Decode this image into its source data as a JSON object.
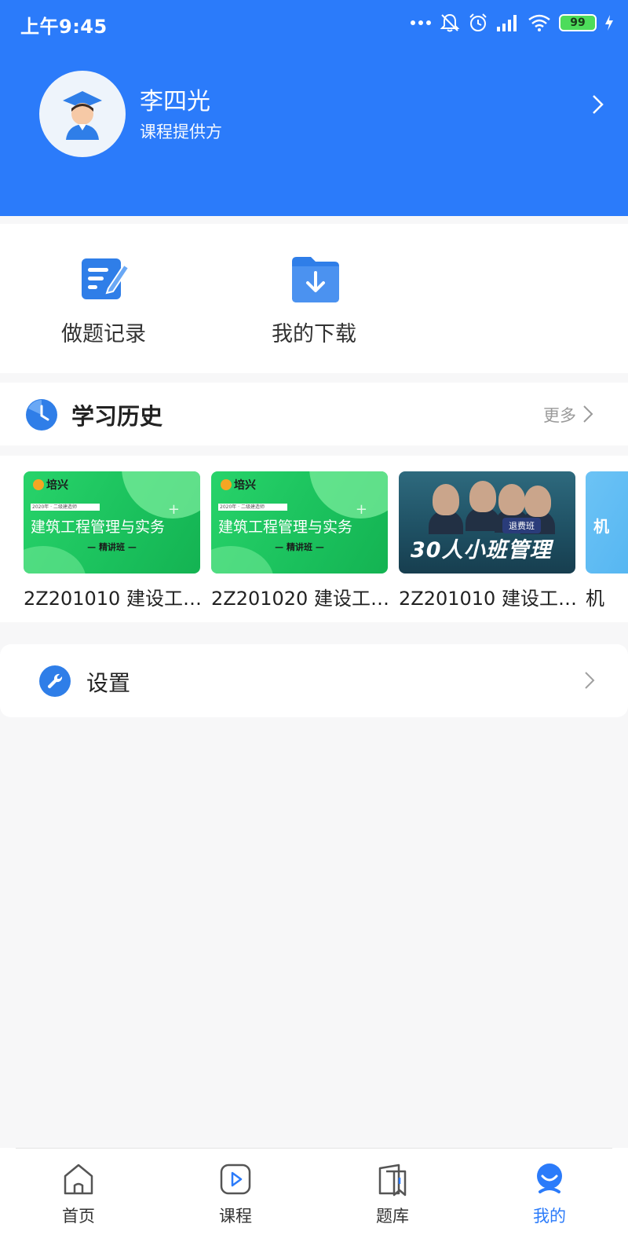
{
  "status_bar": {
    "time": "上午9:45",
    "battery": "99",
    "icons": [
      "dots-icon",
      "bell-off-icon",
      "alarm-icon",
      "signal-icon",
      "wifi-icon",
      "battery-icon",
      "charging-icon"
    ]
  },
  "profile": {
    "name": "李四光",
    "role": "课程提供方"
  },
  "quick_actions": [
    {
      "label": "做题记录",
      "icon": "edit-note-icon"
    },
    {
      "label": "我的下载",
      "icon": "download-folder-icon"
    }
  ],
  "history": {
    "title": "学习历史",
    "more_label": "更多",
    "items": [
      {
        "caption": "2Z201010 建设工…",
        "thumb": {
          "brand": "培兴",
          "strip": "2020年 · 二级建造师",
          "title": "建筑工程管理与实务",
          "sub": "— 精讲班 —"
        }
      },
      {
        "caption": "2Z201020 建设工…",
        "thumb": {
          "brand": "培兴",
          "strip": "2020年 · 二级建造师",
          "title": "建筑工程管理与实务",
          "sub": "— 精讲班 —"
        }
      },
      {
        "caption": "2Z201010 建设工…",
        "thumb": {
          "tag": "退费班",
          "big": "30人小班管理"
        }
      },
      {
        "caption": "机",
        "thumb": {
          "title": "机"
        }
      }
    ]
  },
  "settings": {
    "label": "设置"
  },
  "bottom_nav": {
    "items": [
      {
        "label": "首页",
        "icon": "home-icon",
        "active": false
      },
      {
        "label": "课程",
        "icon": "play-course-icon",
        "active": false
      },
      {
        "label": "题库",
        "icon": "question-bank-icon",
        "active": false
      },
      {
        "label": "我的",
        "icon": "profile-icon",
        "active": true
      }
    ]
  },
  "colors": {
    "brand_blue": "#2b7bfa",
    "background": "#f7f7f8",
    "text_primary": "#222222",
    "text_muted": "#9a9a9a"
  }
}
